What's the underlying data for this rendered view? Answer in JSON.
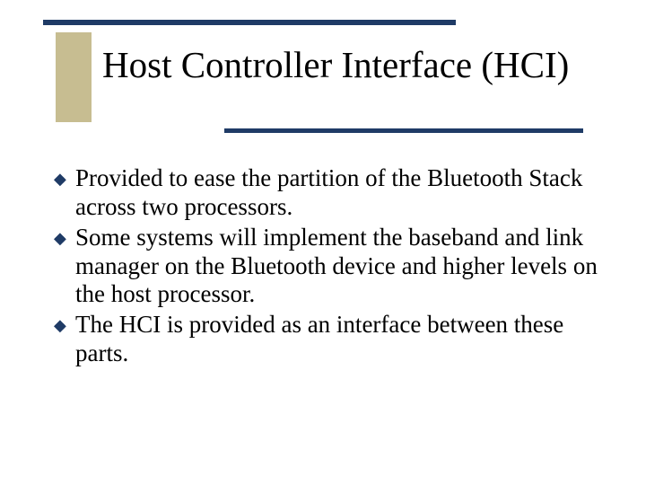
{
  "colors": {
    "accent_line": "#1f3b66",
    "accent_block": "#c7bd91"
  },
  "title": "Host Controller Interface (HCI)",
  "bullets": [
    "Provided to ease the partition of the Bluetooth Stack across two processors.",
    "Some systems will implement the baseband and link manager on the Bluetooth device and higher levels on the host processor.",
    "The HCI is provided as an interface between these parts."
  ]
}
